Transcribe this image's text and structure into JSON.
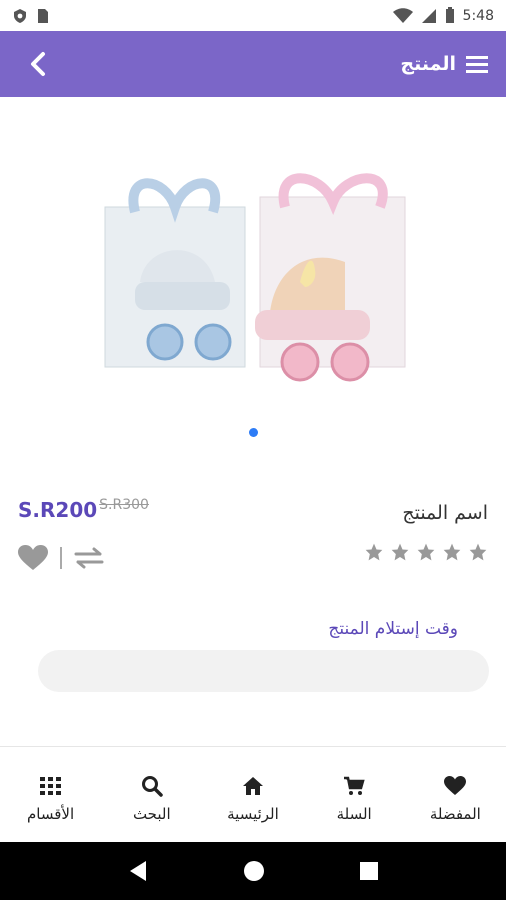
{
  "status": {
    "time": "5:48"
  },
  "header": {
    "title": "المنتج"
  },
  "product": {
    "price": "S.R200",
    "old_price": "S.R300",
    "name": "اسم المنتج",
    "rating": 0,
    "rating_max": 5
  },
  "delivery": {
    "label": "وقت إستلام المنتج",
    "value": ""
  },
  "nav": {
    "categories": "الأقسام",
    "search": "البحث",
    "home": "الرئيسية",
    "cart": "السلة",
    "favorites": "المفضلة"
  },
  "colors": {
    "accent": "#7b66c8",
    "price": "#5b48b8",
    "indicator": "#2d7cf6"
  }
}
